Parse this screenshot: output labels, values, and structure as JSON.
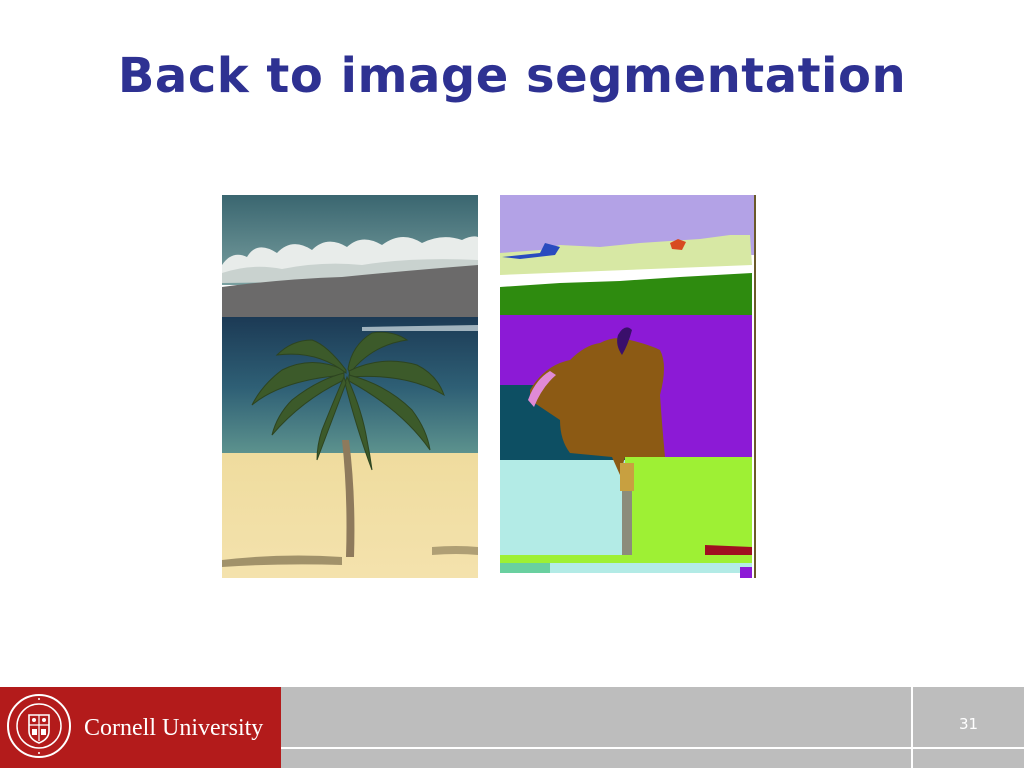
{
  "slide": {
    "title": "Back to image segmentation",
    "page_number": "31"
  },
  "images": {
    "photo_icon": "palm-tree-beach-photo",
    "segmentation_icon": "segmentation-result-image"
  },
  "footer": {
    "university_name": "Cornell University",
    "seal_text": "CORNELL UNIVERSITY FOUNDED A.D. 1865"
  },
  "colors": {
    "title": "#2e3192",
    "footer_red": "#b31b1b",
    "footer_gray": "#bdbdbd"
  }
}
